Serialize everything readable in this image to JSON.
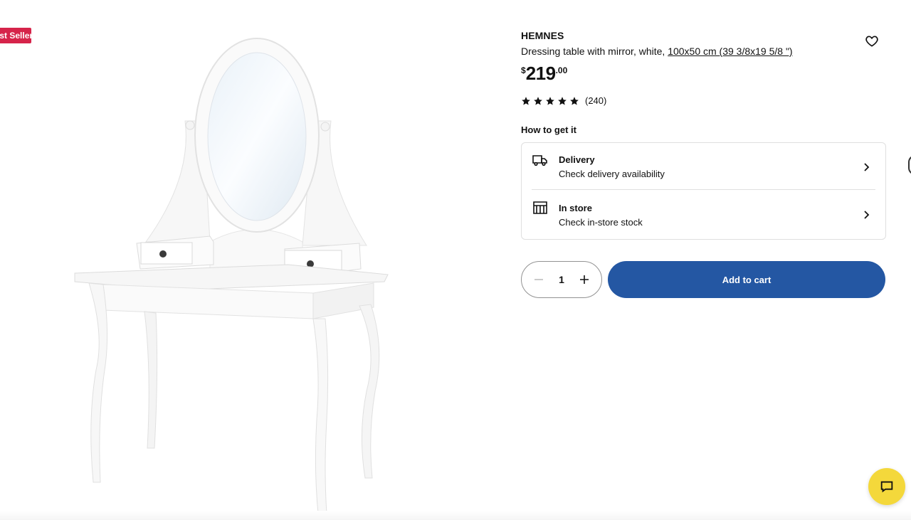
{
  "badge": {
    "label": "Best Seller"
  },
  "product": {
    "brand": "HEMNES",
    "description": "Dressing table with mirror, white, ",
    "size_link": "100x50 cm (39 3/8x19 5/8 \")",
    "price": {
      "currency": "$",
      "integer": "219",
      "decimals": ".00"
    },
    "rating": {
      "stars": 5,
      "count_text": "(240)"
    }
  },
  "fulfillment": {
    "heading": "How to get it",
    "options": [
      {
        "icon": "truck-icon",
        "title": "Delivery",
        "subtitle": "Check delivery availability"
      },
      {
        "icon": "store-icon",
        "title": "In store",
        "subtitle": "Check in-store stock"
      }
    ]
  },
  "purchase": {
    "quantity": "1",
    "add_to_cart": "Add to cart"
  },
  "colors": {
    "primary_button": "#2457a3",
    "badge": "#d6244a",
    "chat": "#f4d83b"
  }
}
